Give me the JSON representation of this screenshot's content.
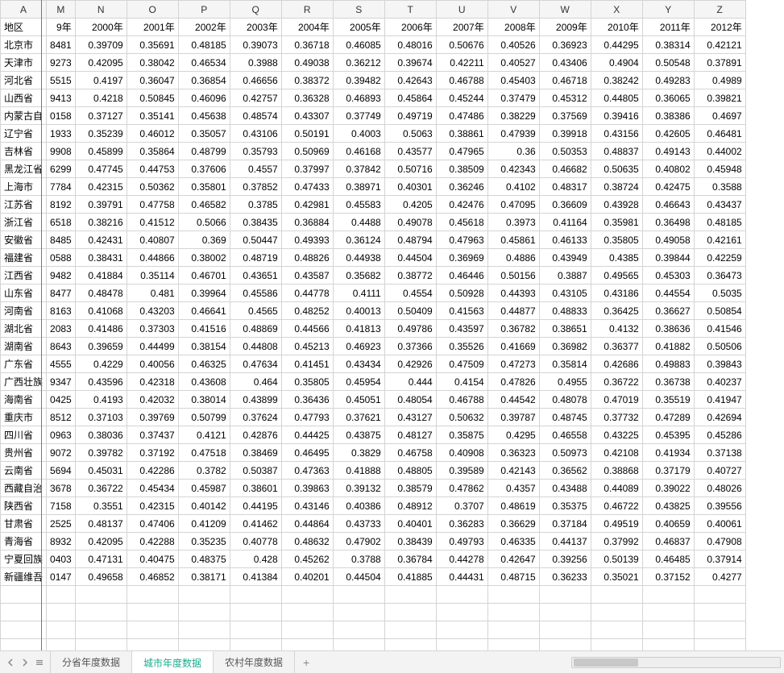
{
  "columns": [
    "A",
    "M",
    "N",
    "O",
    "P",
    "Q",
    "R",
    "S",
    "T",
    "U",
    "V",
    "W",
    "X",
    "Y",
    "Z"
  ],
  "headerRow": [
    "地区",
    "9年",
    "2000年",
    "2001年",
    "2002年",
    "2003年",
    "2004年",
    "2005年",
    "2006年",
    "2007年",
    "2008年",
    "2009年",
    "2010年",
    "2011年",
    "2012年"
  ],
  "rows": [
    {
      "region": "北京市",
      "m": "8481",
      "v": [
        "0.39709",
        "0.35691",
        "0.48185",
        "0.39073",
        "0.36718",
        "0.46085",
        "0.48016",
        "0.50676",
        "0.40526",
        "0.36923",
        "0.44295",
        "0.38314",
        "0.42121"
      ]
    },
    {
      "region": "天津市",
      "m": "9273",
      "v": [
        "0.42095",
        "0.38042",
        "0.46534",
        "0.3988",
        "0.49038",
        "0.36212",
        "0.39674",
        "0.42211",
        "0.40527",
        "0.43406",
        "0.4904",
        "0.50548",
        "0.37891"
      ]
    },
    {
      "region": "河北省",
      "m": "5515",
      "v": [
        "0.4197",
        "0.36047",
        "0.36854",
        "0.46656",
        "0.38372",
        "0.39482",
        "0.42643",
        "0.46788",
        "0.45403",
        "0.46718",
        "0.38242",
        "0.49283",
        "0.4989"
      ]
    },
    {
      "region": "山西省",
      "m": "9413",
      "v": [
        "0.4218",
        "0.50845",
        "0.46096",
        "0.42757",
        "0.36328",
        "0.46893",
        "0.45864",
        "0.45244",
        "0.37479",
        "0.45312",
        "0.44805",
        "0.36065",
        "0.39821"
      ]
    },
    {
      "region": "内蒙古自",
      "m": "0158",
      "v": [
        "0.37127",
        "0.35141",
        "0.45638",
        "0.48574",
        "0.43307",
        "0.37749",
        "0.49719",
        "0.47486",
        "0.38229",
        "0.37569",
        "0.39416",
        "0.38386",
        "0.4697"
      ]
    },
    {
      "region": "辽宁省",
      "m": "1933",
      "v": [
        "0.35239",
        "0.46012",
        "0.35057",
        "0.43106",
        "0.50191",
        "0.4003",
        "0.5063",
        "0.38861",
        "0.47939",
        "0.39918",
        "0.43156",
        "0.42605",
        "0.46481"
      ]
    },
    {
      "region": "吉林省",
      "m": "9908",
      "v": [
        "0.45899",
        "0.35864",
        "0.48799",
        "0.35793",
        "0.50969",
        "0.46168",
        "0.43577",
        "0.47965",
        "0.36",
        "0.50353",
        "0.48837",
        "0.49143",
        "0.44002"
      ]
    },
    {
      "region": "黑龙江省",
      "m": "6299",
      "v": [
        "0.47745",
        "0.44753",
        "0.37606",
        "0.4557",
        "0.37997",
        "0.37842",
        "0.50716",
        "0.38509",
        "0.42343",
        "0.46682",
        "0.50635",
        "0.40802",
        "0.45948"
      ]
    },
    {
      "region": "上海市",
      "m": "7784",
      "v": [
        "0.42315",
        "0.50362",
        "0.35801",
        "0.37852",
        "0.47433",
        "0.38971",
        "0.40301",
        "0.36246",
        "0.4102",
        "0.48317",
        "0.38724",
        "0.42475",
        "0.3588"
      ]
    },
    {
      "region": "江苏省",
      "m": "8192",
      "v": [
        "0.39791",
        "0.47758",
        "0.46582",
        "0.3785",
        "0.42981",
        "0.45583",
        "0.4205",
        "0.42476",
        "0.47095",
        "0.36609",
        "0.43928",
        "0.46643",
        "0.43437"
      ]
    },
    {
      "region": "浙江省",
      "m": "6518",
      "v": [
        "0.38216",
        "0.41512",
        "0.5066",
        "0.38435",
        "0.36884",
        "0.4488",
        "0.49078",
        "0.45618",
        "0.3973",
        "0.41164",
        "0.35981",
        "0.36498",
        "0.48185"
      ]
    },
    {
      "region": "安徽省",
      "m": "8485",
      "v": [
        "0.42431",
        "0.40807",
        "0.369",
        "0.50447",
        "0.49393",
        "0.36124",
        "0.48794",
        "0.47963",
        "0.45861",
        "0.46133",
        "0.35805",
        "0.49058",
        "0.42161"
      ]
    },
    {
      "region": "福建省",
      "m": "0588",
      "v": [
        "0.38431",
        "0.44866",
        "0.38002",
        "0.48719",
        "0.48826",
        "0.44938",
        "0.44504",
        "0.36969",
        "0.4886",
        "0.43949",
        "0.4385",
        "0.39844",
        "0.42259"
      ]
    },
    {
      "region": "江西省",
      "m": "9482",
      "v": [
        "0.41884",
        "0.35114",
        "0.46701",
        "0.43651",
        "0.43587",
        "0.35682",
        "0.38772",
        "0.46446",
        "0.50156",
        "0.3887",
        "0.49565",
        "0.45303",
        "0.36473"
      ]
    },
    {
      "region": "山东省",
      "m": "8477",
      "v": [
        "0.48478",
        "0.481",
        "0.39964",
        "0.45586",
        "0.44778",
        "0.4111",
        "0.4554",
        "0.50928",
        "0.44393",
        "0.43105",
        "0.43186",
        "0.44554",
        "0.5035"
      ]
    },
    {
      "region": "河南省",
      "m": "8163",
      "v": [
        "0.41068",
        "0.43203",
        "0.46641",
        "0.4565",
        "0.48252",
        "0.40013",
        "0.50409",
        "0.41563",
        "0.44877",
        "0.48833",
        "0.36425",
        "0.36627",
        "0.50854"
      ]
    },
    {
      "region": "湖北省",
      "m": "2083",
      "v": [
        "0.41486",
        "0.37303",
        "0.41516",
        "0.48869",
        "0.44566",
        "0.41813",
        "0.49786",
        "0.43597",
        "0.36782",
        "0.38651",
        "0.4132",
        "0.38636",
        "0.41546"
      ]
    },
    {
      "region": "湖南省",
      "m": "8643",
      "v": [
        "0.39659",
        "0.44499",
        "0.38154",
        "0.44808",
        "0.45213",
        "0.46923",
        "0.37366",
        "0.35526",
        "0.41669",
        "0.36982",
        "0.36377",
        "0.41882",
        "0.50506"
      ]
    },
    {
      "region": "广东省",
      "m": "4555",
      "v": [
        "0.4229",
        "0.40056",
        "0.46325",
        "0.47634",
        "0.41451",
        "0.43434",
        "0.42926",
        "0.47509",
        "0.47273",
        "0.35814",
        "0.42686",
        "0.49883",
        "0.39843"
      ]
    },
    {
      "region": "广西壮族",
      "m": "9347",
      "v": [
        "0.43596",
        "0.42318",
        "0.43608",
        "0.464",
        "0.35805",
        "0.45954",
        "0.444",
        "0.4154",
        "0.47826",
        "0.4955",
        "0.36722",
        "0.36738",
        "0.40237"
      ]
    },
    {
      "region": "海南省",
      "m": "0425",
      "v": [
        "0.4193",
        "0.42032",
        "0.38014",
        "0.43899",
        "0.36436",
        "0.45051",
        "0.48054",
        "0.46788",
        "0.44542",
        "0.48078",
        "0.47019",
        "0.35519",
        "0.41947"
      ]
    },
    {
      "region": "重庆市",
      "m": "8512",
      "v": [
        "0.37103",
        "0.39769",
        "0.50799",
        "0.37624",
        "0.47793",
        "0.37621",
        "0.43127",
        "0.50632",
        "0.39787",
        "0.48745",
        "0.37732",
        "0.47289",
        "0.42694"
      ]
    },
    {
      "region": "四川省",
      "m": "0963",
      "v": [
        "0.38036",
        "0.37437",
        "0.4121",
        "0.42876",
        "0.44425",
        "0.43875",
        "0.48127",
        "0.35875",
        "0.4295",
        "0.46558",
        "0.43225",
        "0.45395",
        "0.45286"
      ]
    },
    {
      "region": "贵州省",
      "m": "9072",
      "v": [
        "0.39782",
        "0.37192",
        "0.47518",
        "0.38469",
        "0.46495",
        "0.3829",
        "0.46758",
        "0.40908",
        "0.36323",
        "0.50973",
        "0.42108",
        "0.41934",
        "0.37138"
      ]
    },
    {
      "region": "云南省",
      "m": "5694",
      "v": [
        "0.45031",
        "0.42286",
        "0.3782",
        "0.50387",
        "0.47363",
        "0.41888",
        "0.48805",
        "0.39589",
        "0.42143",
        "0.36562",
        "0.38868",
        "0.37179",
        "0.40727"
      ]
    },
    {
      "region": "西藏自治",
      "m": "3678",
      "v": [
        "0.36722",
        "0.45434",
        "0.45987",
        "0.38601",
        "0.39863",
        "0.39132",
        "0.38579",
        "0.47862",
        "0.4357",
        "0.43488",
        "0.44089",
        "0.39022",
        "0.48026"
      ]
    },
    {
      "region": "陕西省",
      "m": "7158",
      "v": [
        "0.3551",
        "0.42315",
        "0.40142",
        "0.44195",
        "0.43146",
        "0.40386",
        "0.48912",
        "0.3707",
        "0.48619",
        "0.35375",
        "0.46722",
        "0.43825",
        "0.39556"
      ]
    },
    {
      "region": "甘肃省",
      "m": "2525",
      "v": [
        "0.48137",
        "0.47406",
        "0.41209",
        "0.41462",
        "0.44864",
        "0.43733",
        "0.40401",
        "0.36283",
        "0.36629",
        "0.37184",
        "0.49519",
        "0.40659",
        "0.40061"
      ]
    },
    {
      "region": "青海省",
      "m": "8932",
      "v": [
        "0.42095",
        "0.42288",
        "0.35235",
        "0.40778",
        "0.48632",
        "0.47902",
        "0.38439",
        "0.49793",
        "0.46335",
        "0.44137",
        "0.37992",
        "0.46837",
        "0.47908"
      ]
    },
    {
      "region": "宁夏回族",
      "m": "0403",
      "v": [
        "0.47131",
        "0.40475",
        "0.48375",
        "0.428",
        "0.45262",
        "0.3788",
        "0.36784",
        "0.44278",
        "0.42647",
        "0.39256",
        "0.50139",
        "0.46485",
        "0.37914"
      ]
    },
    {
      "region": "新疆维吾",
      "m": "0147",
      "v": [
        "0.49658",
        "0.46852",
        "0.38171",
        "0.41384",
        "0.40201",
        "0.44504",
        "0.41885",
        "0.44431",
        "0.48715",
        "0.36233",
        "0.35021",
        "0.37152",
        "0.4277"
      ]
    }
  ],
  "emptyRows": 4,
  "tabs": [
    {
      "label": "分省年度数据",
      "active": false
    },
    {
      "label": "城市年度数据",
      "active": true
    },
    {
      "label": "农村年度数据",
      "active": false
    }
  ],
  "addTabGlyph": "+"
}
